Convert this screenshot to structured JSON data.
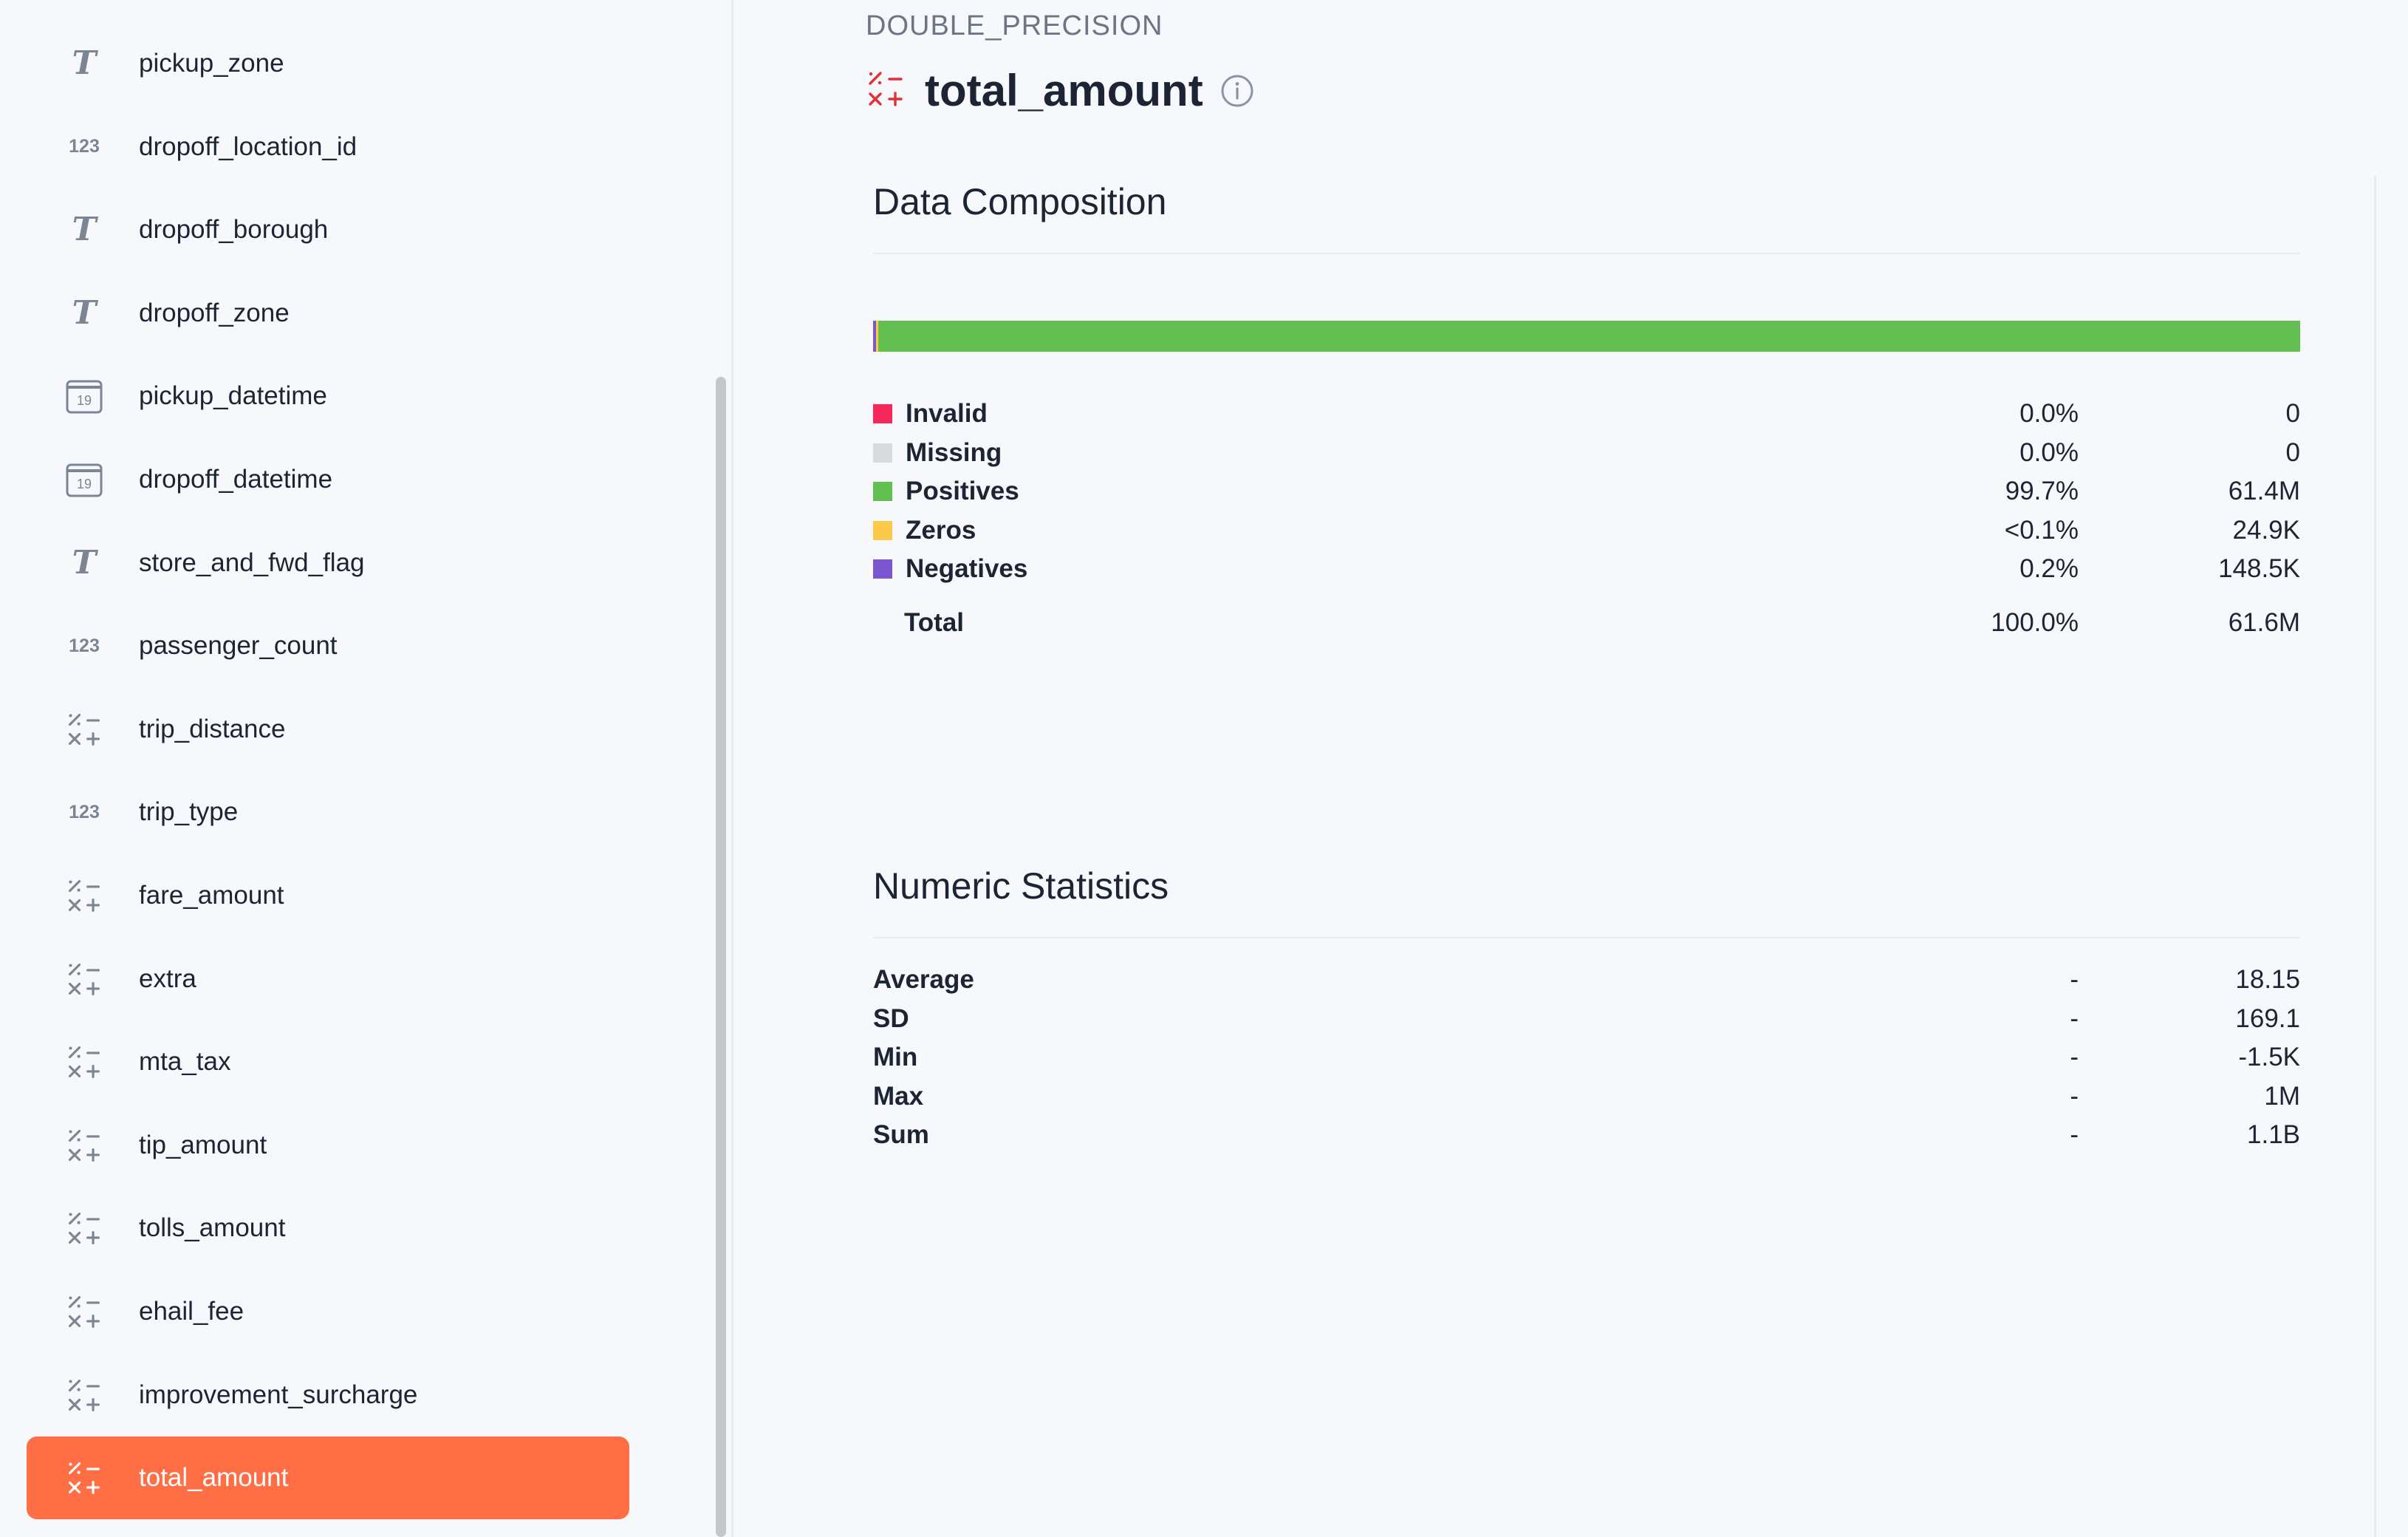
{
  "sidebar": {
    "columns": [
      {
        "label": "pickup_zone",
        "icon": "text-type-icon"
      },
      {
        "label": "dropoff_location_id",
        "icon": "integer-type-icon"
      },
      {
        "label": "dropoff_borough",
        "icon": "text-type-icon"
      },
      {
        "label": "dropoff_zone",
        "icon": "text-type-icon"
      },
      {
        "label": "pickup_datetime",
        "icon": "calendar-type-icon"
      },
      {
        "label": "dropoff_datetime",
        "icon": "calendar-type-icon"
      },
      {
        "label": "store_and_fwd_flag",
        "icon": "text-type-icon"
      },
      {
        "label": "passenger_count",
        "icon": "integer-type-icon"
      },
      {
        "label": "trip_distance",
        "icon": "decimal-type-icon"
      },
      {
        "label": "trip_type",
        "icon": "integer-type-icon"
      },
      {
        "label": "fare_amount",
        "icon": "decimal-type-icon"
      },
      {
        "label": "extra",
        "icon": "decimal-type-icon"
      },
      {
        "label": "mta_tax",
        "icon": "decimal-type-icon"
      },
      {
        "label": "tip_amount",
        "icon": "decimal-type-icon"
      },
      {
        "label": "tolls_amount",
        "icon": "decimal-type-icon"
      },
      {
        "label": "ehail_fee",
        "icon": "decimal-type-icon"
      },
      {
        "label": "improvement_surcharge",
        "icon": "decimal-type-icon"
      },
      {
        "label": "total_amount",
        "icon": "decimal-type-icon",
        "selected": true
      }
    ],
    "calendar_day": "19",
    "integer_glyph": "123",
    "text_glyph": "T"
  },
  "column": {
    "data_type": "DOUBLE_PRECISION",
    "name": "total_amount"
  },
  "composition": {
    "title": "Data Composition",
    "rows": [
      {
        "label": "Invalid",
        "pct": "0.0%",
        "value": "0",
        "color": "#f5285a"
      },
      {
        "label": "Missing",
        "pct": "0.0%",
        "value": "0",
        "color": "#d9dadc"
      },
      {
        "label": "Positives",
        "pct": "99.7%",
        "value": "61.4M",
        "color": "#63bf4f"
      },
      {
        "label": "Zeros",
        "pct": "<0.1%",
        "value": "24.9K",
        "color": "#fcc94a"
      },
      {
        "label": "Negatives",
        "pct": "0.2%",
        "value": "148.5K",
        "color": "#7a57d1"
      }
    ],
    "total": {
      "label": "Total",
      "pct": "100.0%",
      "value": "61.6M"
    },
    "bar_fractions": {
      "Negatives": 0.002,
      "Zeros": 0.0004,
      "Positives": 0.9976
    }
  },
  "stats": {
    "title": "Numeric Statistics",
    "rows": [
      {
        "label": "Average",
        "pct": "-",
        "value": "18.15"
      },
      {
        "label": "SD",
        "pct": "-",
        "value": "169.1"
      },
      {
        "label": "Min",
        "pct": "-",
        "value": "-1.5K"
      },
      {
        "label": "Max",
        "pct": "-",
        "value": "1M"
      },
      {
        "label": "Sum",
        "pct": "-",
        "value": "1.1B"
      }
    ]
  },
  "colors": {
    "accent": "#ff6e45",
    "decimal_icon_red": "#e0303a"
  }
}
